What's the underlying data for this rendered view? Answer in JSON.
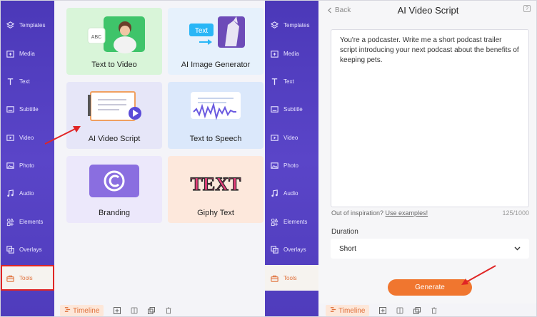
{
  "sidebar": {
    "items": [
      {
        "label": "Templates",
        "icon": "layers-icon"
      },
      {
        "label": "Media",
        "icon": "media-icon"
      },
      {
        "label": "Text",
        "icon": "text-icon"
      },
      {
        "label": "Subtitle",
        "icon": "subtitle-icon"
      },
      {
        "label": "Video",
        "icon": "video-icon"
      },
      {
        "label": "Photo",
        "icon": "photo-icon"
      },
      {
        "label": "Audio",
        "icon": "audio-icon"
      },
      {
        "label": "Elements",
        "icon": "elements-icon"
      },
      {
        "label": "Overlays",
        "icon": "overlays-icon"
      },
      {
        "label": "Tools",
        "icon": "tools-icon"
      }
    ],
    "active": "Tools"
  },
  "tools": [
    {
      "label": "Text to Video",
      "badge": "ABC"
    },
    {
      "label": "AI Image Generator",
      "badge": "Text"
    },
    {
      "label": "AI Video Script"
    },
    {
      "label": "Text to Speech"
    },
    {
      "label": "Branding"
    },
    {
      "label": "Giphy Text",
      "art_text": "TEXT"
    }
  ],
  "bottom_bar": {
    "timeline_label": "Timeline"
  },
  "script_panel": {
    "back_label": "Back",
    "title": "AI Video Script",
    "help": "?",
    "prompt_text": "You're a podcaster. Write me a short podcast trailer script introducing your next podcast about the benefits of keeping pets.",
    "hint_prefix": "Out of inspiration? ",
    "hint_link": "Use examples!",
    "counter": "125/1000",
    "duration_label": "Duration",
    "duration_value": "Short",
    "generate_label": "Generate"
  },
  "colors": {
    "sidebar": "#4f3cbc",
    "accent": "#f0762f",
    "annotation": "#e02525"
  }
}
